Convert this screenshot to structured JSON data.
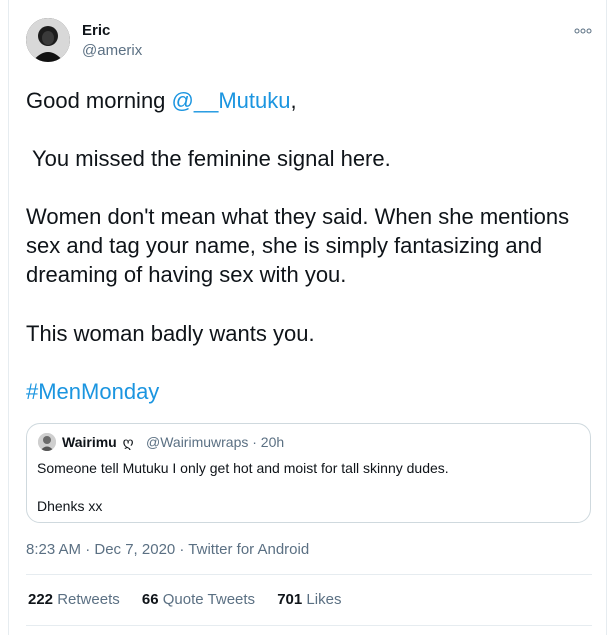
{
  "tweet": {
    "author_name": "Eric",
    "author_handle": "@amerix",
    "more_icon": "more-icon",
    "greeting_text": "Good morning ",
    "greeting_mention": "@__Mutuku",
    "greeting_comma": ",",
    "line2": "You missed the feminine signal here.",
    "line3": "Women don't mean what they said. When she mentions sex and tag your name, she is simply fantasizing and dreaming of having sex with you.",
    "line4": "This woman badly wants you.",
    "hashtag": "#MenMonday",
    "timestamp": "8:23 AM · Dec 7, 2020 · Twitter for Android"
  },
  "quote": {
    "author_name": "Wairimu",
    "author_emoji": "ღ",
    "author_meta": "@Wairimuwraps · 20h",
    "text1": "Someone tell Mutuku I only get hot and moist for tall skinny dudes.",
    "text2": "Dhenks xx"
  },
  "stats": {
    "retweets_count": "222",
    "retweets_label": "Retweets",
    "quotes_count": "66",
    "quotes_label": "Quote Tweets",
    "likes_count": "701",
    "likes_label": "Likes"
  },
  "colors": {
    "link": "#1b95e0",
    "text": "#0f1419",
    "muted": "#5b7083",
    "border": "#cfd9de"
  }
}
